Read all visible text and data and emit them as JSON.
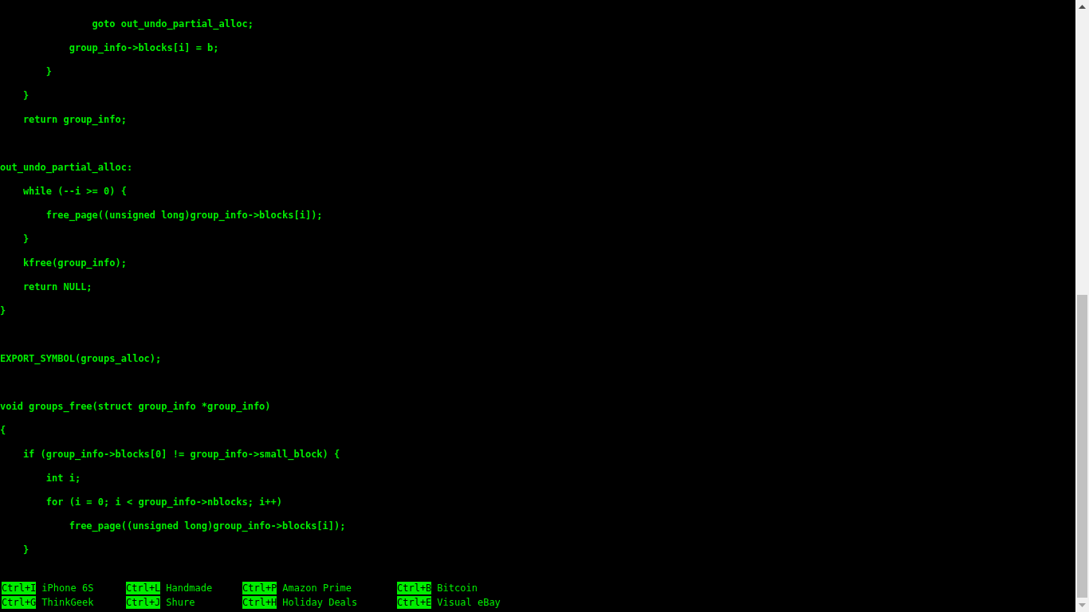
{
  "code_blocks": [
    {
      "lines": [
        "                goto out_undo_partial_alloc;",
        "            group_info->blocks[i] = b;",
        "        }",
        "    }",
        "    return group_info;"
      ]
    },
    {
      "lines": [
        "out_undo_partial_alloc:",
        "    while (--i >= 0) {",
        "        free_page((unsigned long)group_info->blocks[i]);",
        "    }",
        "    kfree(group_info);",
        "    return NULL;",
        "}"
      ]
    },
    {
      "lines": [
        "EXPORT_SYMBOL(groups_alloc);"
      ]
    },
    {
      "lines": [
        "void groups_free(struct group_info *group_info)",
        "{",
        "    if (group_info->blocks[0] != group_info->small_block) {",
        "        int i;",
        "        for (i = 0; i < group_info->nblocks; i++)",
        "            free_page((unsigned long)group_info->blocks[i]);",
        "    }"
      ]
    }
  ],
  "shortcuts": [
    {
      "key": "Ctrl+I",
      "label": "iPhone 6S"
    },
    {
      "key": "Ctrl+L",
      "label": "Handmade"
    },
    {
      "key": "Ctrl+P",
      "label": "Amazon Prime"
    },
    {
      "key": "Ctrl+B",
      "label": "Bitcoin"
    },
    {
      "key": "Ctrl+G",
      "label": "ThinkGeek"
    },
    {
      "key": "Ctrl+J",
      "label": "Shure"
    },
    {
      "key": "Ctrl+H",
      "label": "Holiday Deals"
    },
    {
      "key": "Ctrl+E",
      "label": "Visual eBay"
    }
  ]
}
